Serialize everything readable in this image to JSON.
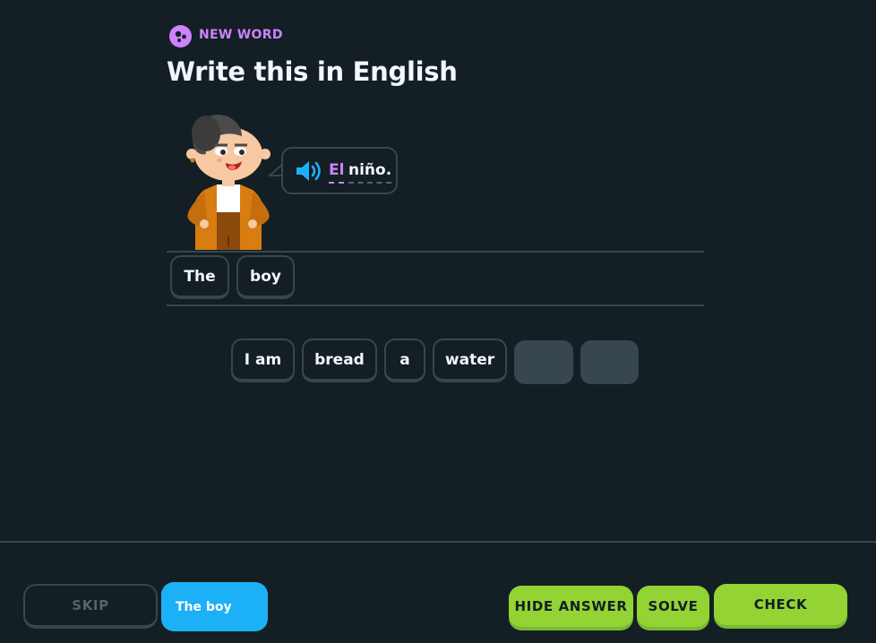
{
  "header": {
    "badge_label": "NEW WORD",
    "title": "Write this in English",
    "badge_icon": "sparkle-icon"
  },
  "prompt": {
    "speaker_icon": "speaker-icon",
    "words": [
      "El",
      "niño."
    ]
  },
  "answer": {
    "tiles": [
      "The",
      "boy"
    ]
  },
  "word_bank": {
    "tiles": [
      "I am",
      "bread",
      "a",
      "water"
    ]
  },
  "footer": {
    "skip_label": "SKIP",
    "answer_label": "The boy",
    "hide_answer_label": "HIDE ANSWER",
    "solve_label": "SOLVE",
    "check_label": "CHECK"
  },
  "colors": {
    "background": "#131f24",
    "purple": "#ce82ff",
    "blue": "#1cb0f6",
    "green": "#93d333",
    "border": "#37464f"
  }
}
